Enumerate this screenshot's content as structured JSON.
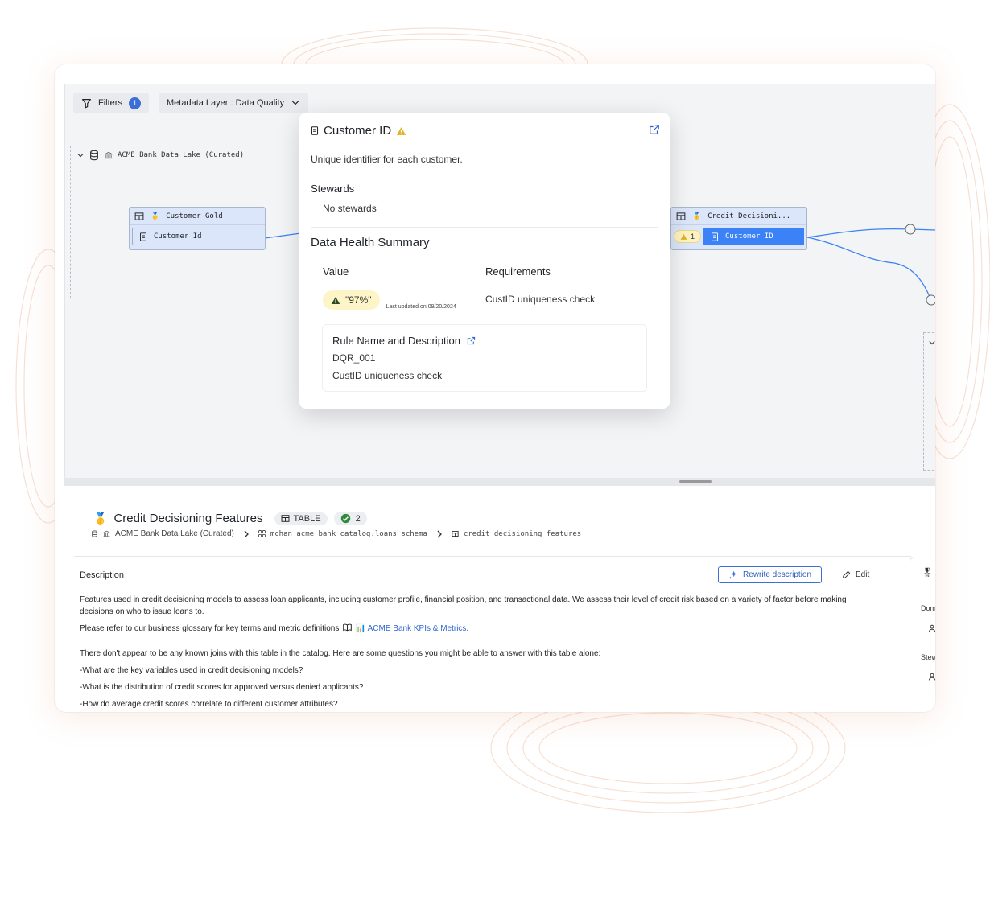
{
  "toolbar": {
    "filters_label": "Filters",
    "filters_count": "1",
    "metadata_layer_label": "Metadata Layer : Data Quality"
  },
  "lineage": {
    "group_name": "ACME Bank Data Lake (Curated)",
    "left_node": {
      "title": "Customer Gold",
      "column": "Customer Id"
    },
    "right_node": {
      "title": "Credit Decisioni...",
      "column": "Customer ID",
      "warning_count": "1"
    }
  },
  "popover": {
    "title": "Customer ID",
    "description": "Unique identifier for each customer.",
    "stewards_heading": "Stewards",
    "stewards_value": "No stewards",
    "health_heading": "Data Health Summary",
    "value_heading": "Value",
    "requirements_heading": "Requirements",
    "value": "\"97%\"",
    "last_updated": "Last updated on 09/20/2024",
    "requirement": "CustID uniqueness check",
    "rule_heading": "Rule Name and Description",
    "rule_id": "DQR_001",
    "rule_description": "CustID uniqueness check"
  },
  "details": {
    "title": "Credit Decisioning Features",
    "type_label": "TABLE",
    "check_count": "2",
    "breadcrumb": {
      "lake": "ACME Bank Data Lake (Curated)",
      "schema": "mchan_acme_bank_catalog.loans_schema",
      "table": "credit_decisioning_features"
    },
    "description_label": "Description",
    "rewrite_label": "Rewrite description",
    "edit_label": "Edit",
    "paragraph_1": "Features used in credit decisioning models to assess loan applicants, including customer profile, financial position, and transactional data. We assess their level of credit risk based on a variety of factor before making decisions on who to issue loans to.",
    "paragraph_2_prefix": "Please refer to our business glossary for key terms and metric definitions",
    "glossary_link": "ACME Bank KPIs & Metrics",
    "paragraph_3": "There don't appear to be any known joins with this table in the catalog. Here are some questions you might be able to answer with this table alone:",
    "question_1": "-What are the key variables used in credit decisioning models?",
    "question_2": "-What is the distribution of credit scores for approved versus denied applicants?",
    "question_3": "-How do average credit scores correlate to different customer attributes?"
  },
  "side_panel": {
    "domain_label": "Dom",
    "stewards_label": "Stew"
  },
  "colors": {
    "accent": "#3b82f6",
    "warning": "#e0b323",
    "success": "#2e8b3a"
  }
}
